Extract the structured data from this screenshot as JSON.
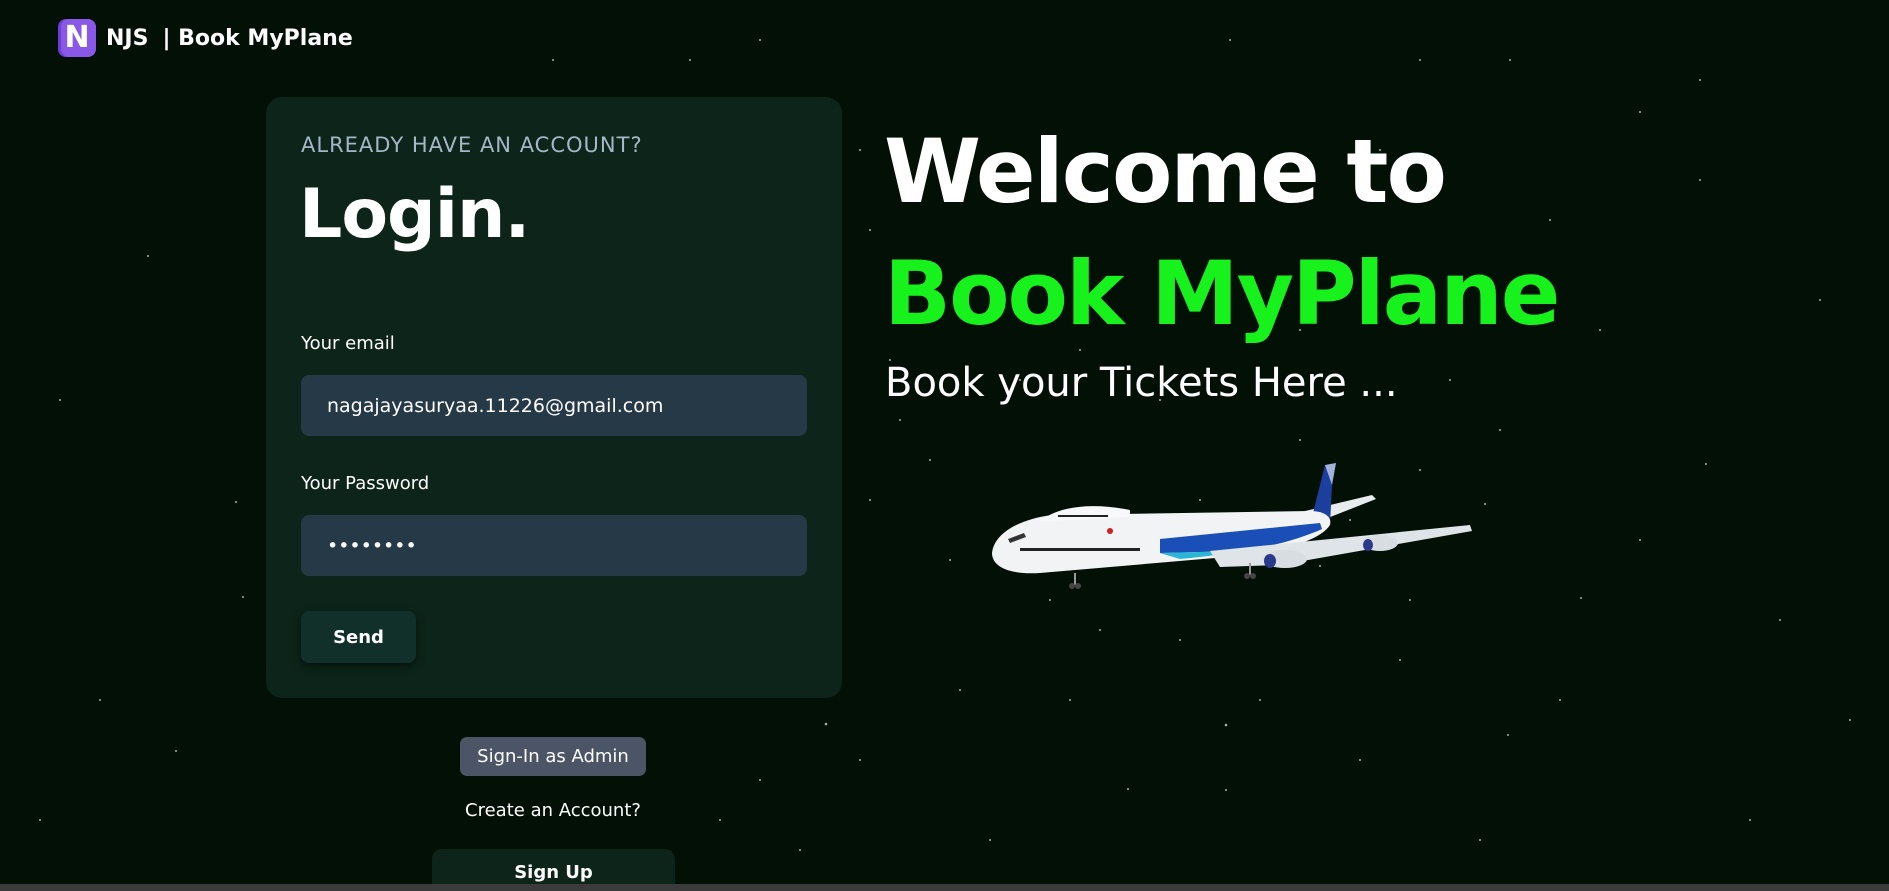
{
  "header": {
    "logo_letter": "N",
    "brand_name": "NJS",
    "brand_suffix": "| Book MyPlane"
  },
  "login": {
    "pretitle": "ALREADY HAVE AN ACCOUNT?",
    "title": "Login.",
    "email_label": "Your email",
    "email_value": "nagajayasuryaa.11226@gmail.com",
    "password_label": "Your Password",
    "password_value": "••••••••",
    "send_label": "Send"
  },
  "links": {
    "admin_label": "Sign-In as Admin",
    "create_account_text": "Create an Account?",
    "signup_label": "Sign Up"
  },
  "hero": {
    "line1": "Welcome to",
    "line2": "Book MyPlane",
    "subtitle": "Book your Tickets Here ..."
  },
  "colors": {
    "background": "#031005",
    "card": "#0c2419",
    "input": "#263946",
    "accent_green": "#18f21c",
    "logo_purple": "#8a58e8",
    "admin_button": "#4b5565"
  },
  "icons": {
    "logo": "njs-logo-icon",
    "plane": "airplane-image"
  }
}
